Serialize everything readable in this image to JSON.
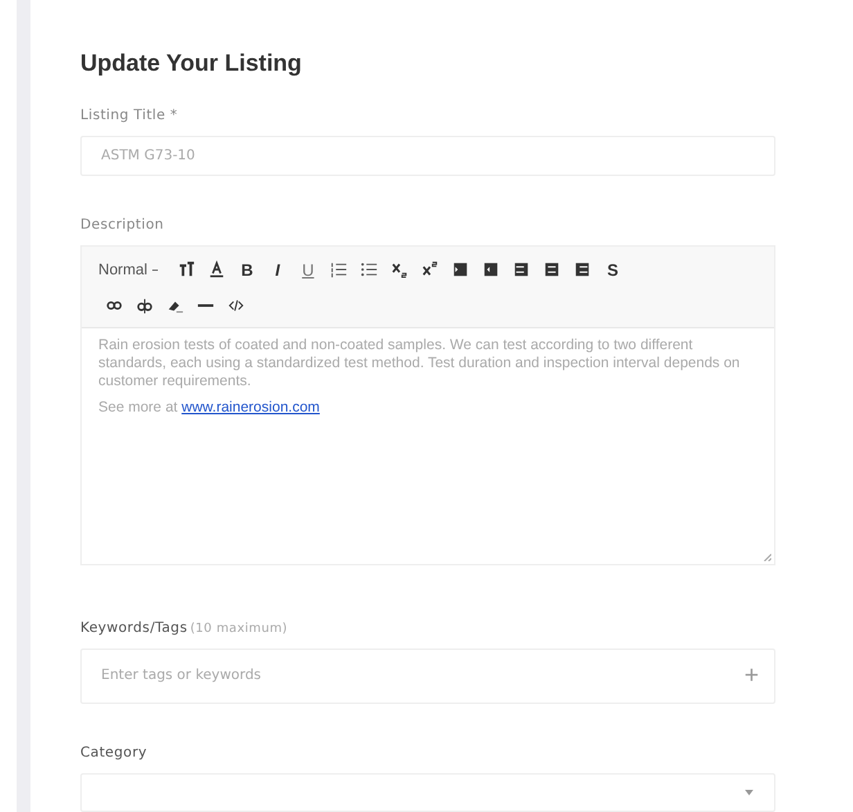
{
  "form": {
    "title": "Update Your Listing",
    "listing_title": {
      "label": "Listing Title *",
      "value": "ASTM G73-10"
    },
    "description": {
      "label": "Description",
      "toolbar": {
        "format": "Normal",
        "buttons": [
          {
            "kind": "text-height"
          },
          {
            "kind": "font-color"
          },
          {
            "kind": "bold",
            "glyph": "B"
          },
          {
            "kind": "italic",
            "glyph": "I"
          },
          {
            "kind": "underline",
            "glyph": "U"
          },
          {
            "kind": "ordered-list"
          },
          {
            "kind": "bullet-list"
          },
          {
            "kind": "subscript"
          },
          {
            "kind": "superscript"
          },
          {
            "kind": "indent"
          },
          {
            "kind": "outdent"
          },
          {
            "kind": "align-left"
          },
          {
            "kind": "align-center"
          },
          {
            "kind": "align-right"
          },
          {
            "kind": "strike",
            "glyph": "S"
          },
          {
            "kind": "link"
          },
          {
            "kind": "unlink"
          },
          {
            "kind": "eraser"
          },
          {
            "kind": "rule"
          },
          {
            "kind": "code"
          }
        ]
      },
      "paragraph": "Rain erosion tests of coated and non-coated samples. We can test according to two different standards, each using a standardized test method. Test duration and inspection interval depends on customer requirements.",
      "more_prefix": "See more at",
      "more_link": "www.rainerosion.com"
    },
    "keywords": {
      "label": "Keywords/Tags",
      "hint": "(10 maximum)",
      "placeholder": "Enter tags or keywords",
      "add": "+"
    },
    "category": {
      "label": "Category"
    }
  }
}
